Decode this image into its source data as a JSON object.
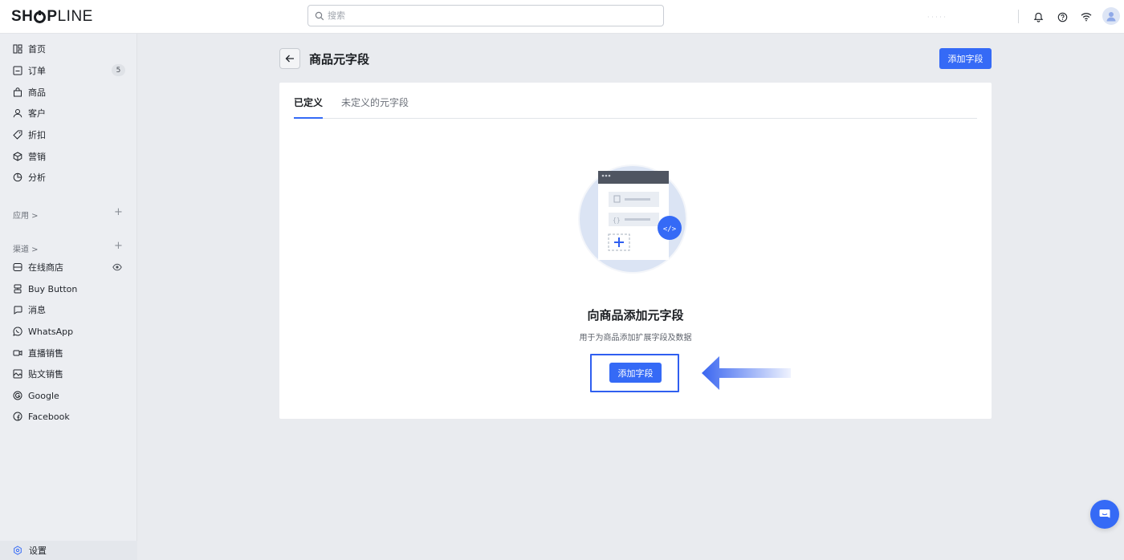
{
  "brand": {
    "logo_pre": "SH",
    "logo_mid": "P",
    "logo_post": "LINE"
  },
  "search": {
    "placeholder": "搜索"
  },
  "header": {
    "store_name": "· · · · ·"
  },
  "sidebar": {
    "items": [
      {
        "label": "首页",
        "icon": "home-icon"
      },
      {
        "label": "订单",
        "icon": "orders-icon",
        "badge": "5"
      },
      {
        "label": "商品",
        "icon": "product-bag-icon"
      },
      {
        "label": "客户",
        "icon": "customer-icon"
      },
      {
        "label": "折扣",
        "icon": "discount-tag-icon"
      },
      {
        "label": "营销",
        "icon": "marketing-icon"
      },
      {
        "label": "分析",
        "icon": "analytics-icon"
      }
    ],
    "apps_label": "应用 >",
    "channels_label": "渠道 >",
    "channels": [
      {
        "label": "在线商店",
        "icon": "online-store-icon"
      },
      {
        "label": "Buy Button",
        "icon": "buy-button-icon"
      },
      {
        "label": "消息",
        "icon": "message-icon"
      },
      {
        "label": "WhatsApp",
        "icon": "whatsapp-icon"
      },
      {
        "label": "直播销售",
        "icon": "live-sales-icon"
      },
      {
        "label": "贴文销售",
        "icon": "post-sales-icon"
      },
      {
        "label": "Google",
        "icon": "google-icon"
      },
      {
        "label": "Facebook",
        "icon": "facebook-icon"
      }
    ],
    "settings_label": "设置"
  },
  "main": {
    "title": "商品元字段",
    "add_button": "添加字段",
    "tabs": [
      {
        "label": "已定义",
        "active": true
      },
      {
        "label": "未定义的元字段",
        "active": false
      }
    ],
    "empty": {
      "title": "向商品添加元字段",
      "description": "用于为商品添加扩展字段及数据",
      "button": "添加字段"
    }
  },
  "colors": {
    "accent": "#356af6",
    "highlight": "#2f5ff0"
  }
}
